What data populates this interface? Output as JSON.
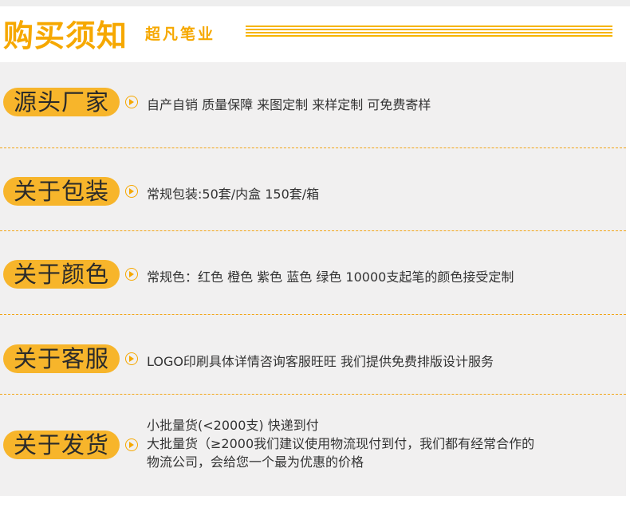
{
  "header": {
    "title": "购买须知",
    "subtitle": "超凡笔业"
  },
  "sections": [
    {
      "label": "源头厂家",
      "text": "自产自销 质量保障 来图定制 来样定制  可免费寄样"
    },
    {
      "label": "关于包装",
      "text": "常规包装:50套/内盒 150套/箱"
    },
    {
      "label": "关于颜色",
      "text": " 常规色：红色 橙色 紫色 蓝色 绿色     10000支起笔的颜色接受定制"
    },
    {
      "label": "关于客服",
      "text": " LOGO印刷具体详情咨询客服旺旺 我们提供免费排版设计服务"
    },
    {
      "label": "关于发货",
      "lines": [
        "小批量货(<2000支) 快递到付",
        "大批量货（≥2000我们建议使用物流现付到付，我们都有经常合作的",
        "物流公司，会给您一个最为优惠的价格"
      ]
    }
  ],
  "colors": {
    "accent": "#f6a800",
    "pill": "#f7b52b",
    "panel": "#f1f0f0",
    "divider": "#f2a516"
  },
  "icons": {
    "bullet": "play-circle-icon"
  }
}
